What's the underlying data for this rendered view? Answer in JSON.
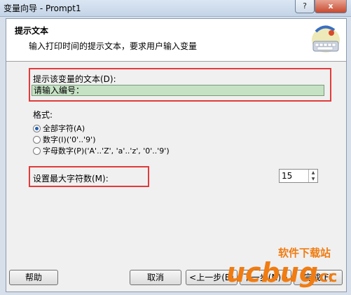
{
  "window": {
    "title": "变量向导 - Prompt1",
    "help_label": "?",
    "close_label": "x"
  },
  "header": {
    "title": "提示文本",
    "subtitle": "输入打印时间的提示文本，要求用户输入变量"
  },
  "prompt": {
    "label": "提示该变量的文本(D):",
    "value": "请输入编号："
  },
  "format": {
    "label": "格式:",
    "options": [
      {
        "label": "全部字符(A)",
        "selected": true
      },
      {
        "label": "数字(I)('0'..'9')",
        "selected": false
      },
      {
        "label": "字母数字(P)('A'..'Z', 'a'..'z', '0'..'9')",
        "selected": false
      }
    ]
  },
  "max_chars": {
    "label": "设置最大字符数(M):",
    "value": "15"
  },
  "buttons": {
    "help": "帮助",
    "cancel": "取消",
    "back": "<上一步(B)",
    "next": "下一步(N)>",
    "finish": "完成(F)"
  },
  "watermark": {
    "site": "软件下载站",
    "brand": "ucbug",
    "tld": ".cc"
  },
  "colors": {
    "highlight": "#e23b3b",
    "input_bg": "#c6e2c4",
    "watermark": "#f07c12"
  }
}
